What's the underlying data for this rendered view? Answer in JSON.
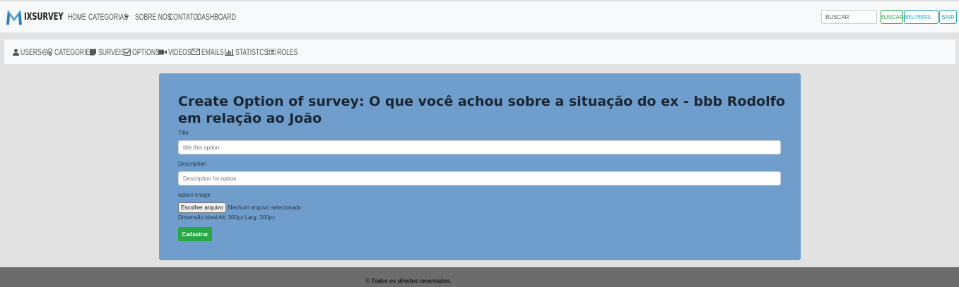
{
  "navbar": {
    "brand_mark": "M",
    "brand_text": "IXSURVEY",
    "links": {
      "home": "HOME",
      "categories": "CATEGORIAS",
      "about": "SOBRE NÓS",
      "contact": "CONTATO",
      "dashboard": "DASHBOARD"
    },
    "search_placeholder": "BUSCAR",
    "search_button": "BUSCAR",
    "profile_button": "MEU PERFIL",
    "exit_button": "SAIR"
  },
  "admin_menu": {
    "users": "USERS",
    "categories": "CATEGORIES",
    "surveys": "SURVEIS",
    "options": "OPTIONS",
    "videos": "VIDEOS",
    "emails": "EMAILS",
    "statistics": "STATISTCS",
    "roles": "ROLES"
  },
  "form": {
    "heading": "Create Option of survey: O que você achou sobre a situação do ex - bbb Rodolfo em relação ao João",
    "title_label": "Title",
    "title_placeholder": "title this option",
    "description_label": "Description",
    "description_placeholder": "Description for option",
    "image_label": "option image",
    "file_button": "Escolher arquivo",
    "file_status": "Nenhum arquivo selecionado",
    "image_hint": "Dimensão ideal Alt: 300px Larg: 300px",
    "submit": "Cadastrar"
  },
  "footer": {
    "text": "© Todos os direitos reservados."
  },
  "colors": {
    "panel": "#6f9ecd",
    "success": "#28a745",
    "info": "#17a2b8",
    "footer": "#6c6c6c"
  }
}
